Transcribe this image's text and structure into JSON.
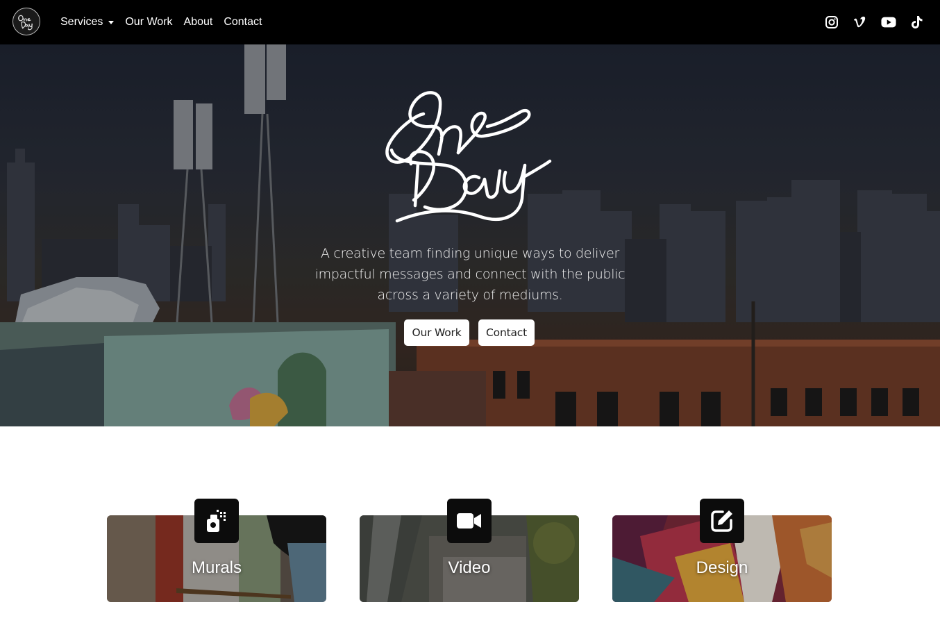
{
  "nav": {
    "logo_text": "One Day",
    "links": [
      {
        "label": "Services",
        "dropdown": true
      },
      {
        "label": "Our Work"
      },
      {
        "label": "About"
      },
      {
        "label": "Contact"
      }
    ],
    "social_icons": [
      "instagram-icon",
      "vimeo-icon",
      "youtube-icon",
      "tiktok-icon"
    ]
  },
  "hero": {
    "logo_text": "One Day",
    "tagline": "A creative team finding unique ways to deliver impactful messages and connect with the public across a variety of mediums.",
    "buttons": [
      {
        "label": "Our Work"
      },
      {
        "label": "Contact"
      }
    ]
  },
  "services": [
    {
      "title": "Murals",
      "icon": "spray-can-icon"
    },
    {
      "title": "Video",
      "icon": "video-camera-icon"
    },
    {
      "title": "Design",
      "icon": "edit-icon"
    }
  ]
}
